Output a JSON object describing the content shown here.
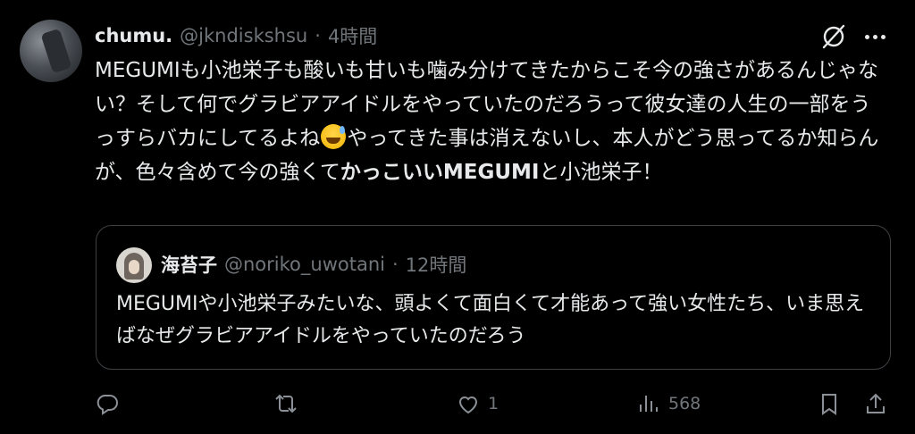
{
  "tweet": {
    "name": "chumu.",
    "handle": "@jkndiskshsu",
    "separator": "·",
    "time": "4時間",
    "text_part1": "MEGUMIも小池栄子も酸いも甘いも噛み分けてきたからこそ今の強さがあるんじゃない？そして何でグラビアアイドルをやっていたのだろうって彼女達の人生の一部をうっすらバカにしてるよね",
    "emoji": "grinning-face-with-sweat",
    "text_part2": "やってきた事は消えないし、本人がどう思ってるか知らんが、色々含めて今の強くて",
    "text_bold": "かっこいいMEGUMI",
    "text_part3": "と小池栄子！"
  },
  "quote": {
    "name": "海苔子",
    "handle": "@noriko_uwotani",
    "separator": "·",
    "time": "12時間",
    "text": "MEGUMIや小池栄子みたいな、頭よくて面白くて才能あって強い女性たち、いま思えばなぜグラビアアイドルをやっていたのだろう"
  },
  "actions": {
    "reply_count": "",
    "retweet_count": "",
    "like_count": "1",
    "views_count": "568"
  },
  "icons": [
    "grok-icon",
    "more-icon",
    "reply-icon",
    "retweet-icon",
    "like-icon",
    "views-icon",
    "bookmark-icon",
    "share-icon"
  ]
}
